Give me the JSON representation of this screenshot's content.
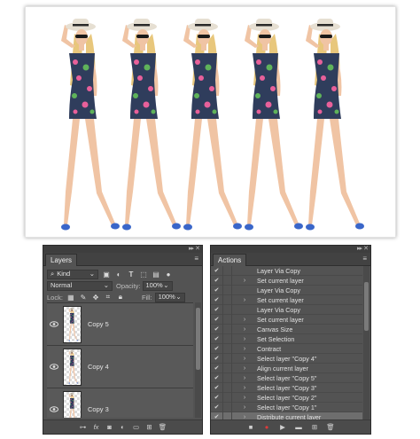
{
  "layers_panel": {
    "tab": "Layers",
    "filter_kind": "Kind",
    "blend_mode": "Normal",
    "opacity_label": "Opacity:",
    "opacity_value": "100%",
    "lock_label": "Lock:",
    "fill_label": "Fill:",
    "fill_value": "100%",
    "layers": [
      {
        "name": "Copy 5"
      },
      {
        "name": "Copy 4"
      },
      {
        "name": "Copy 3"
      }
    ],
    "filter_icons": [
      "image-filter-icon",
      "adjustment-filter-icon",
      "type-filter-icon",
      "shape-filter-icon",
      "smart-object-filter-icon",
      "filter-toggle-icon"
    ],
    "lock_icons": [
      "lock-transparent-icon",
      "lock-image-icon",
      "lock-position-icon",
      "lock-artboard-icon",
      "lock-all-icon"
    ],
    "footer_icons": [
      "link-layers-icon",
      "fx-icon",
      "add-mask-icon",
      "adjustment-layer-icon",
      "group-icon",
      "new-layer-icon",
      "trash-icon"
    ]
  },
  "actions_panel": {
    "tab": "Actions",
    "items": [
      {
        "label": "Layer Via Copy",
        "expandable": false
      },
      {
        "label": "Set current layer",
        "expandable": true
      },
      {
        "label": "Layer Via Copy",
        "expandable": false
      },
      {
        "label": "Set current layer",
        "expandable": true
      },
      {
        "label": "Layer Via Copy",
        "expandable": false
      },
      {
        "label": "Set current layer",
        "expandable": true
      },
      {
        "label": "Canvas Size",
        "expandable": true
      },
      {
        "label": "Set Selection",
        "expandable": true
      },
      {
        "label": "Contract",
        "expandable": true
      },
      {
        "label": "Select layer \"Copy 4\"",
        "expandable": true
      },
      {
        "label": "Align current layer",
        "expandable": true
      },
      {
        "label": "Select layer \"Copy 5\"",
        "expandable": true
      },
      {
        "label": "Select layer \"Copy 3\"",
        "expandable": true
      },
      {
        "label": "Select layer \"Copy 2\"",
        "expandable": true
      },
      {
        "label": "Select layer \"Copy 1\"",
        "expandable": true
      },
      {
        "label": "Distribute current layer",
        "expandable": true
      }
    ],
    "selected_item": "Distribute current layer",
    "footer_icons": [
      "stop-icon",
      "record-icon",
      "play-icon",
      "new-set-icon",
      "new-action-icon",
      "trash-icon"
    ],
    "record_color": "#e03a3a"
  },
  "colors": {
    "panel_bg": "#535353",
    "dress_bg": "#2f3d5c",
    "dress_pink": "#e8609a",
    "dress_green": "#5fb35a",
    "hair": "#e8c77c",
    "skin": "#f0c4a4",
    "shoe": "#3a66c9",
    "hat": "#e6dfd2"
  }
}
